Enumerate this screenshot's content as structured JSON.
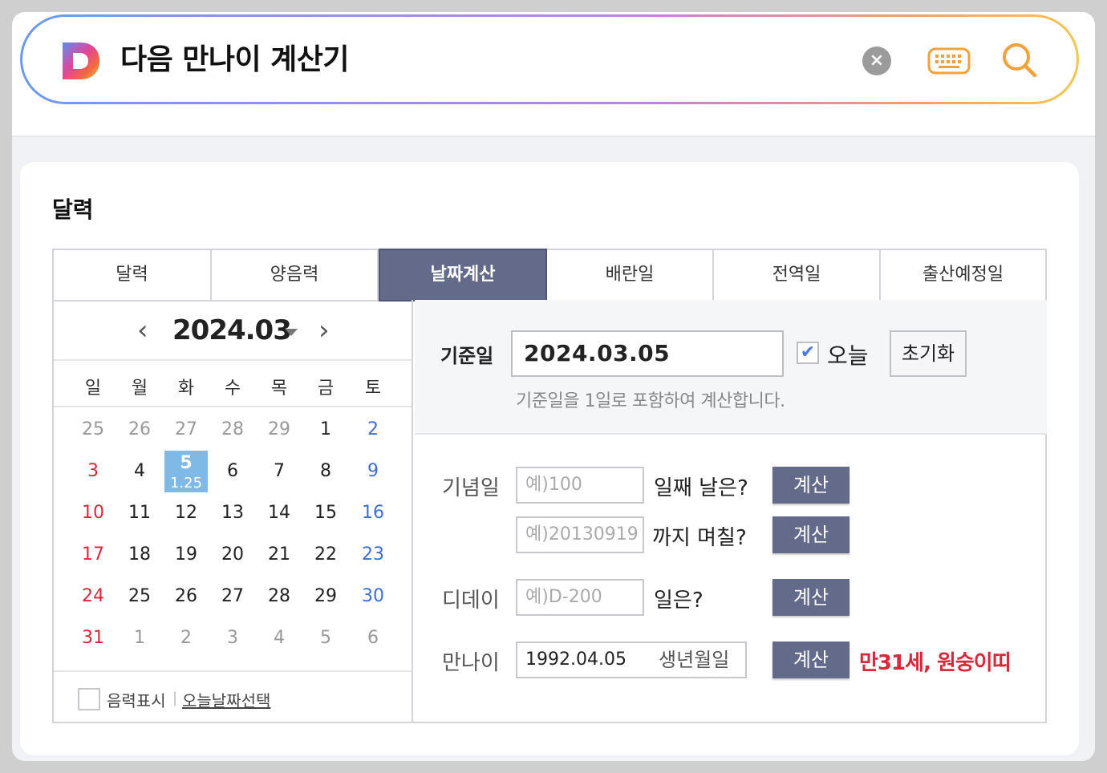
{
  "search": {
    "query": "다음 만나이 계산기",
    "clear_glyph": "×"
  },
  "card": {
    "title": "달력"
  },
  "tabs": [
    {
      "label": "달력"
    },
    {
      "label": "양음력"
    },
    {
      "label": "날짜계산",
      "active": true
    },
    {
      "label": "배란일"
    },
    {
      "label": "전역일"
    },
    {
      "label": "출산예정일"
    }
  ],
  "calendar": {
    "prev_glyph": "‹",
    "next_glyph": "›",
    "month": "2024.03",
    "dow": [
      "일",
      "월",
      "화",
      "수",
      "목",
      "금",
      "토"
    ],
    "weeks": [
      [
        "25",
        "26",
        "27",
        "28",
        "29",
        "1",
        "2"
      ],
      [
        "3",
        "4",
        "5",
        "6",
        "7",
        "8",
        "9"
      ],
      [
        "10",
        "11",
        "12",
        "13",
        "14",
        "15",
        "16"
      ],
      [
        "17",
        "18",
        "19",
        "20",
        "21",
        "22",
        "23"
      ],
      [
        "24",
        "25",
        "26",
        "27",
        "28",
        "29",
        "30"
      ],
      [
        "31",
        "1",
        "2",
        "3",
        "4",
        "5",
        "6"
      ]
    ],
    "today_lunar": "1.25",
    "footer": {
      "lunar_label": "음력표시",
      "separator": "|",
      "today_link": "오늘날짜선택"
    }
  },
  "calc": {
    "base_label": "기준일",
    "base_value": "2024.03.05",
    "today_check": "✔",
    "today_label": "오늘",
    "reset_label": "초기화",
    "note": "기준일을 1일로 포함하여 계산합니다.",
    "anniversary": {
      "label": "기념일",
      "days_placeholder": "예)100",
      "days_text": "일째 날은?",
      "date_placeholder": "예)20130919",
      "date_text": "까지 며칠?"
    },
    "dday": {
      "label": "디데이",
      "placeholder": "예)D-200",
      "text": "일은?"
    },
    "age": {
      "label": "만나이",
      "value": "1992.04.05",
      "suffix": "생년월일",
      "result": "만31세, 원숭이띠"
    },
    "button_label": "계산"
  },
  "colors": {
    "accent": "#646b8a",
    "sunday": "#d8283a",
    "saturday": "#3c6fcf",
    "today_bg": "#7fb9e5",
    "result": "#d8283a"
  }
}
